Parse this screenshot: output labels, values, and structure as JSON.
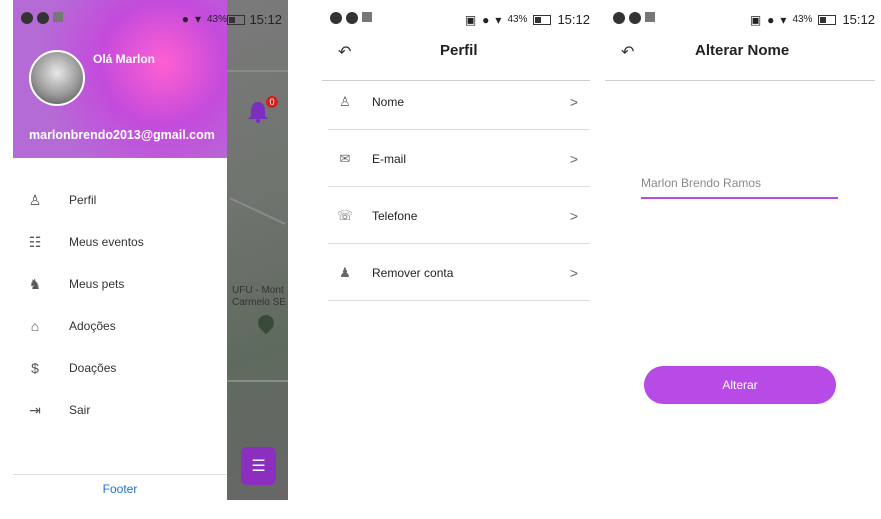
{
  "status": {
    "battery": "43%",
    "time": "15:12"
  },
  "drawer": {
    "greeting": "Olá Marlon",
    "email": "marlonbrendo2013@gmail.com",
    "items": [
      {
        "label": "Perfil",
        "icon": "person-icon"
      },
      {
        "label": "Meus eventos",
        "icon": "list-icon"
      },
      {
        "label": "Meus pets",
        "icon": "pet-icon"
      },
      {
        "label": "Adoções",
        "icon": "adoption-icon"
      },
      {
        "label": "Doações",
        "icon": "donation-icon"
      },
      {
        "label": "Sair",
        "icon": "logout-icon"
      }
    ],
    "footer": "Footer"
  },
  "map": {
    "badge": "0",
    "place_line1": "UFU - Mont",
    "place_line2": "Carmelo SE"
  },
  "profile": {
    "title": "Perfil",
    "items": [
      {
        "label": "Nome",
        "icon": "person-icon"
      },
      {
        "label": "E-mail",
        "icon": "mail-icon"
      },
      {
        "label": "Telefone",
        "icon": "phone-icon"
      },
      {
        "label": "Remover conta",
        "icon": "remove-user-icon"
      }
    ],
    "chevron": ">"
  },
  "alter_name": {
    "title": "Alterar Nome",
    "placeholder": "Marlon Brendo Ramos",
    "button": "Alterar"
  },
  "colors": {
    "accent": "#b84be6",
    "drawer_header": "#c44bdc",
    "footer_link": "#1f6fd0"
  }
}
